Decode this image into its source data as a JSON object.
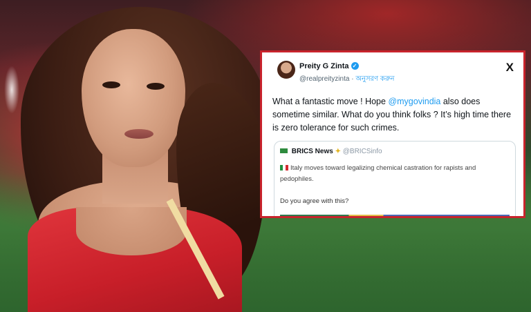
{
  "tweet": {
    "author_name": "Preity G Zinta",
    "handle": "@realpreityzinta",
    "separator": "·",
    "follow_label": "অনুসরণ করুন",
    "logo": "X",
    "text_before": "What a fantastic move ! Hope ",
    "mention": "@mygovindia",
    "text_after": " also does sometime similar.  What do you think folks ? It’s high time there is zero tolerance for such crimes.",
    "quoted": {
      "name": "BRICS News",
      "handle": "@BRICSinfo",
      "text": "Italy moves toward legalizing chemical castration for rapists and pedophiles.",
      "question": "Do you agree with this?"
    }
  },
  "colors": {
    "card_border": "#c8232c",
    "link": "#1d9bf0",
    "jersey": "#d42a32"
  },
  "icons": [
    "verified-badge-icon",
    "x-logo-icon",
    "brazil-flag-icon",
    "italy-flag-icon",
    "gold-verified-icon"
  ]
}
